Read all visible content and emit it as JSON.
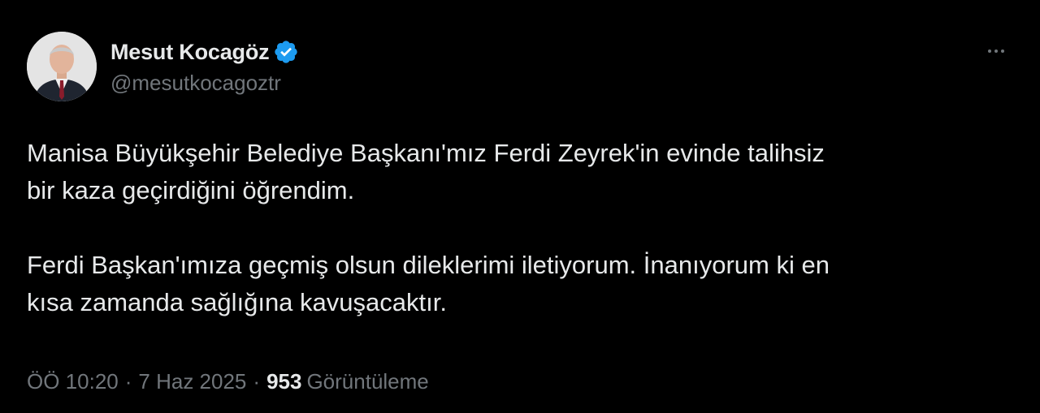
{
  "author": {
    "display_name": "Mesut Kocagöz",
    "handle": "@mesutkocagoztr",
    "verified_icon": "verified-badge-icon",
    "verified_color": "#1d9bf0"
  },
  "menu": {
    "icon": "more-horizontal-icon"
  },
  "tweet": {
    "lines": [
      "Manisa Büyükşehir Belediye Başkanı'mız Ferdi Zeyrek'in evinde talihsiz",
      "bir kaza geçirdiğini öğrendim.",
      "Ferdi Başkan'ımıza geçmiş olsun dileklerimi iletiyorum. İnanıyorum ki en",
      "kısa zamanda sağlığına kavuşacaktır."
    ]
  },
  "meta": {
    "time": "ÖÖ 10:20",
    "separator": "·",
    "date": "7 Haz 2025",
    "views_count": "953",
    "views_label": "Görüntüleme"
  },
  "colors": {
    "background": "#000000",
    "primary_text": "#e7e9ea",
    "secondary_text": "#71767b"
  }
}
